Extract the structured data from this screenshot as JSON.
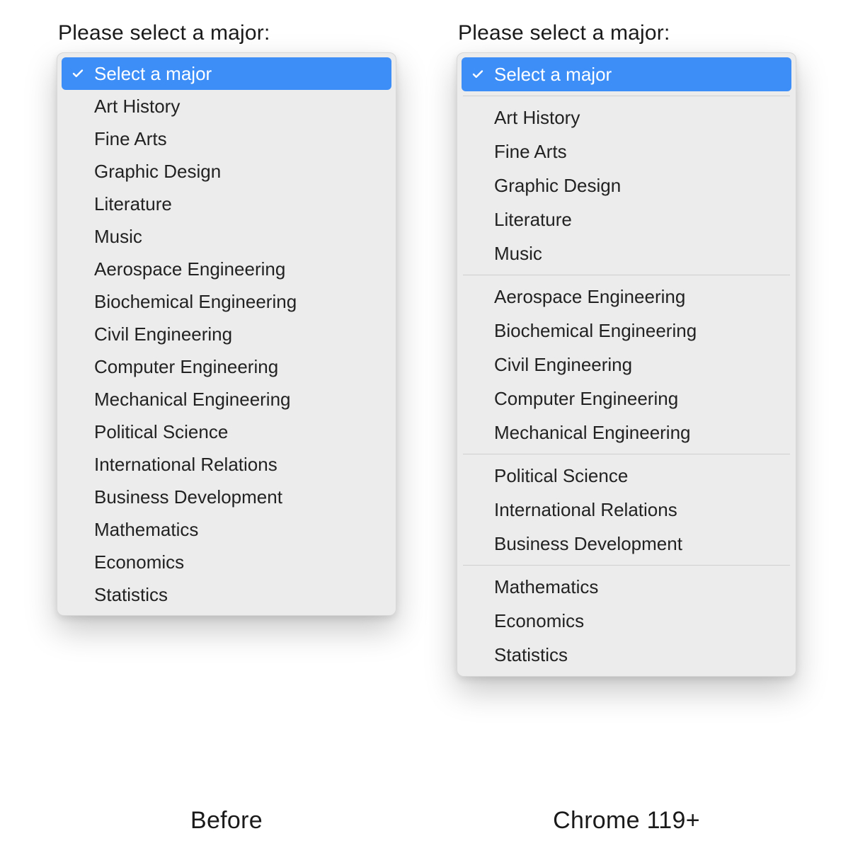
{
  "colors": {
    "highlight": "#3e8ef7",
    "menu_bg": "#ececec",
    "text": "#222222"
  },
  "left": {
    "label": "Please select a major:",
    "caption": "Before",
    "selected": "Select a major",
    "items": [
      "Art History",
      "Fine Arts",
      "Graphic Design",
      "Literature",
      "Music",
      "Aerospace Engineering",
      "Biochemical Engineering",
      "Civil Engineering",
      "Computer Engineering",
      "Mechanical Engineering",
      "Political Science",
      "International Relations",
      "Business Development",
      "Mathematics",
      "Economics",
      "Statistics"
    ]
  },
  "right": {
    "label": "Please select a major:",
    "caption": "Chrome 119+",
    "selected": "Select a major",
    "groups": [
      [
        "Art History",
        "Fine Arts",
        "Graphic Design",
        "Literature",
        "Music"
      ],
      [
        "Aerospace Engineering",
        "Biochemical Engineering",
        "Civil Engineering",
        "Computer Engineering",
        "Mechanical Engineering"
      ],
      [
        "Political Science",
        "International Relations",
        "Business Development"
      ],
      [
        "Mathematics",
        "Economics",
        "Statistics"
      ]
    ]
  }
}
